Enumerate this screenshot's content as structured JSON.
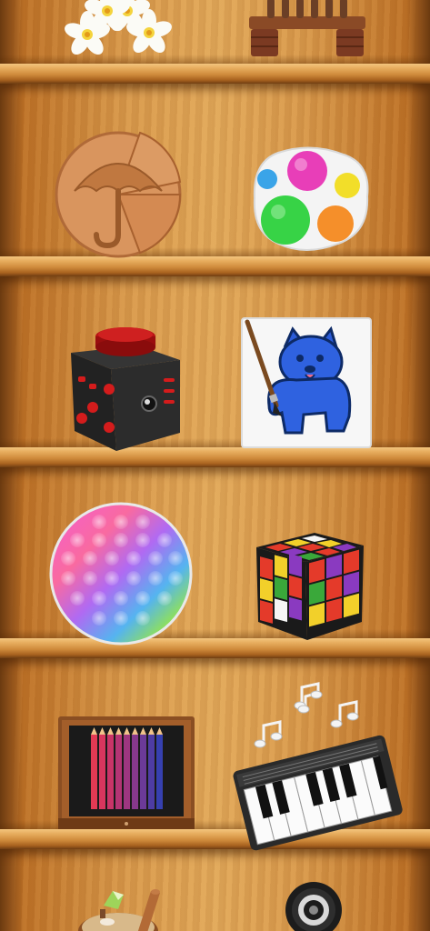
{
  "screen": "toy-shelf",
  "shelves": 6,
  "items": [
    {
      "name": "flowers",
      "icon": "flower-icon"
    },
    {
      "name": "abacus",
      "icon": "abacus-icon"
    },
    {
      "name": "wooden-puzzle",
      "icon": "umbrella-puzzle-icon"
    },
    {
      "name": "simple-dimple",
      "icon": "pop-button-icon"
    },
    {
      "name": "fidget-cube",
      "icon": "fidget-cube-icon"
    },
    {
      "name": "coloring-book",
      "icon": "paint-dog-icon"
    },
    {
      "name": "pop-it",
      "icon": "bubble-pop-icon"
    },
    {
      "name": "rubiks-cube",
      "icon": "cube-puzzle-icon"
    },
    {
      "name": "colored-pencils",
      "icon": "pencil-box-icon"
    },
    {
      "name": "piano",
      "icon": "piano-icon"
    },
    {
      "name": "zen-garden",
      "icon": "sand-garden-icon"
    },
    {
      "name": "fidget-spinner",
      "icon": "spinner-icon"
    }
  ],
  "colors": {
    "wood_light": "#e2a95a",
    "wood_dark": "#8a4e19",
    "shelf_edge": "#f3c57e"
  }
}
